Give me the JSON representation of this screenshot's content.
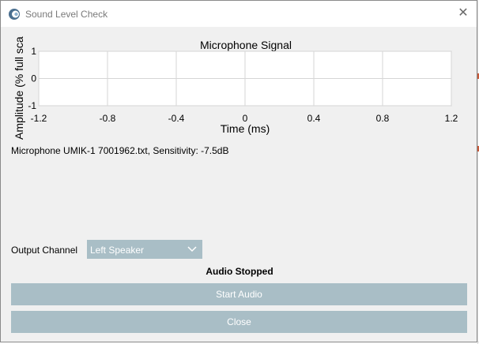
{
  "window": {
    "title": "Sound Level Check",
    "icon": "app-logo-icon",
    "close_icon": "close-icon"
  },
  "chart": {
    "title": "Microphone Signal",
    "xlabel": "Time (ms)",
    "ylabel": "Amplitude (% full sca",
    "xticks": [
      "-1.2",
      "-0.8",
      "-0.4",
      "0",
      "0.4",
      "0.8",
      "1.2"
    ],
    "yticks": [
      "1",
      "0",
      "-1"
    ]
  },
  "chart_data": {
    "type": "line",
    "title": "Microphone Signal",
    "xlabel": "Time (ms)",
    "ylabel": "Amplitude (% full sca",
    "xlim": [
      -1.2,
      1.2
    ],
    "ylim": [
      -1,
      1
    ],
    "xticks": [
      -1.2,
      -0.8,
      -0.4,
      0,
      0.4,
      0.8,
      1.2
    ],
    "yticks": [
      1,
      0,
      -1
    ],
    "grid": true,
    "series": []
  },
  "mic_info": "Microphone UMIK-1 7001962.txt, Sensitivity: -7.5dB",
  "output": {
    "label": "Output Channel",
    "selected": "Left Speaker"
  },
  "status": "Audio Stopped",
  "buttons": {
    "start": "Start Audio",
    "close": "Close"
  },
  "colors": {
    "button_bg": "#a9bec6",
    "button_text": "#ffffff",
    "dialog_bg": "#f0f0f0"
  }
}
